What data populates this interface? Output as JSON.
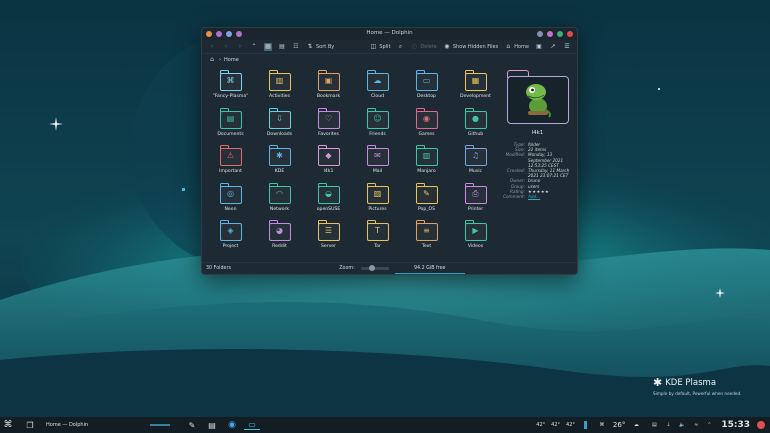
{
  "window": {
    "title": "Home — Dolphin",
    "dot_colors": [
      "#e3904a",
      "#b06fd3",
      "#7aa3e6",
      "#b06fd3"
    ],
    "right_dot_colors": [
      "#8390b6",
      "#c66fd0",
      "#38b07a",
      "#e04b4b"
    ]
  },
  "toolbar": {
    "sort_label": "Sort By",
    "split_label": "Split",
    "delete_label": "Delete",
    "hidden_label": "Show Hidden Files",
    "home_label": "Home"
  },
  "breadcrumb": {
    "label": "Home"
  },
  "items": [
    {
      "label": "\"Fancy-Plasma\"",
      "icon": "kde-command-icon",
      "glyph": "⌘",
      "color": "#7fd0ee"
    },
    {
      "label": "Activities",
      "icon": "activities-icon",
      "glyph": "▥",
      "color": "#e8c25a"
    },
    {
      "label": "Bookmark",
      "icon": "bookmark-icon",
      "glyph": "▣",
      "color": "#e0a060"
    },
    {
      "label": "Cloud",
      "icon": "cloud-icon",
      "glyph": "☁",
      "color": "#5fb4e6"
    },
    {
      "label": "Desktop",
      "icon": "desktop-icon",
      "glyph": "▭",
      "color": "#5fb4e6"
    },
    {
      "label": "Development",
      "icon": "development-icon",
      "glyph": "▦",
      "color": "#e8c25a"
    },
    {
      "label": "Documents",
      "icon": "documents-icon",
      "glyph": "▤",
      "color": "#3ec7a3"
    },
    {
      "label": "Downloads",
      "icon": "downloads-icon",
      "glyph": "⇩",
      "color": "#66d0e0"
    },
    {
      "label": "Favorites",
      "icon": "favorites-icon",
      "glyph": "♡",
      "color": "#c98ae6"
    },
    {
      "label": "Friends",
      "icon": "friends-icon",
      "glyph": "☺",
      "color": "#3ec7a3"
    },
    {
      "label": "Games",
      "icon": "games-icon",
      "glyph": "◉",
      "color": "#e06a8a"
    },
    {
      "label": "Github",
      "icon": "github-icon",
      "glyph": "●",
      "color": "#3ec7a3"
    },
    {
      "label": "Important",
      "icon": "important-icon",
      "glyph": "⚠",
      "color": "#e06a6a"
    },
    {
      "label": "KDE",
      "icon": "kde-icon",
      "glyph": "✱",
      "color": "#5fb4e6"
    },
    {
      "label": "l4k1",
      "icon": "gecko-icon",
      "glyph": "◆",
      "color": "#d79ad7"
    },
    {
      "label": "Mail",
      "icon": "mail-icon",
      "glyph": "✉",
      "color": "#c98ae6"
    },
    {
      "label": "Manjaro",
      "icon": "manjaro-icon",
      "glyph": "▥",
      "color": "#3ec7a3"
    },
    {
      "label": "Music",
      "icon": "music-icon",
      "glyph": "♫",
      "color": "#7aa3e6"
    },
    {
      "label": "Neon",
      "icon": "neon-icon",
      "glyph": "◎",
      "color": "#5fb4e6"
    },
    {
      "label": "Network",
      "icon": "network-icon",
      "glyph": "◠",
      "color": "#3ec7a3"
    },
    {
      "label": "openSUSE",
      "icon": "opensuse-icon",
      "glyph": "◒",
      "color": "#3ec7a3"
    },
    {
      "label": "Pictures",
      "icon": "pictures-icon",
      "glyph": "▨",
      "color": "#e8c25a"
    },
    {
      "label": "Pop_OS",
      "icon": "popos-icon",
      "glyph": "✎",
      "color": "#e8c25a"
    },
    {
      "label": "Printer",
      "icon": "printer-icon",
      "glyph": "⎙",
      "color": "#c98ae6"
    },
    {
      "label": "Project",
      "icon": "project-icon",
      "glyph": "◈",
      "color": "#5fb4e6"
    },
    {
      "label": "Reddit",
      "icon": "reddit-icon",
      "glyph": "◕",
      "color": "#c98ae6"
    },
    {
      "label": "Server",
      "icon": "server-icon",
      "glyph": "☰",
      "color": "#e8c25a"
    },
    {
      "label": "Tar",
      "icon": "tar-icon",
      "glyph": "T",
      "color": "#e8c25a"
    },
    {
      "label": "Text",
      "icon": "text-icon",
      "glyph": "≡",
      "color": "#e0a060"
    },
    {
      "label": "Videos",
      "icon": "videos-icon",
      "glyph": "▶",
      "color": "#3ec7a3"
    }
  ],
  "panel": {
    "name": "l4k1",
    "details": [
      {
        "key": "Type:",
        "value": "folder"
      },
      {
        "key": "Size:",
        "value": "22 items"
      },
      {
        "key": "Modified:",
        "value": "Monday, 13 September 2021 12:53:25 CEST"
      },
      {
        "key": "Created:",
        "value": "Thursday, 11 March 2021 23:07:21 CET"
      },
      {
        "key": "Owner:",
        "value": "bruno"
      },
      {
        "key": "Group:",
        "value": "users"
      },
      {
        "key": "Rating:",
        "value": "★★★★★"
      },
      {
        "key": "Comment:",
        "value": "Add..."
      }
    ]
  },
  "status": {
    "count": "30 Folders",
    "zoom_label": "Zoom:",
    "free": "94.2 GiB free",
    "free_fraction": 0.3
  },
  "taskbar": {
    "task_label": "Home — Dolphin",
    "temps": [
      "42°",
      "42°",
      "42°"
    ],
    "weather_temp": "26°",
    "clock": "15:33"
  },
  "branding": {
    "title": "KDE Plasma",
    "subtitle": "Simple by default, Powerful when needed."
  }
}
